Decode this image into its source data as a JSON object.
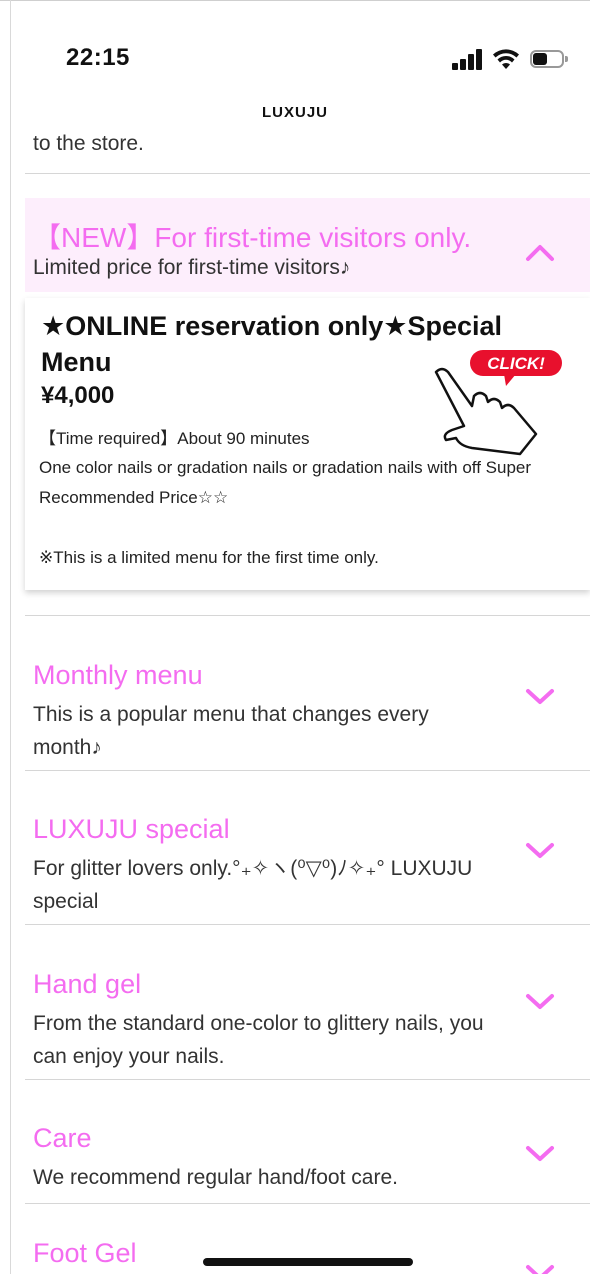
{
  "status_bar": {
    "time": "22:15",
    "battery_level": 0.5
  },
  "app": {
    "title": "LUXUJU"
  },
  "partial_text": "to the store.",
  "new_section": {
    "title": "【NEW】For first-time visitors only.",
    "subtitle": "Limited price for first-time visitors♪",
    "expanded": true,
    "card": {
      "title": "★ONLINE reservation only★Special Menu",
      "price": "¥4,000",
      "time_required": "【Time required】About 90 minutes",
      "description": "One color nails or gradation nails or gradation nails with off Super Recommended Price☆☆",
      "note": "※This is a limited menu for the first time only.",
      "click_badge": "CLICK!"
    }
  },
  "menu_items": [
    {
      "title": "Monthly menu",
      "description": "This is a popular menu that changes every month♪"
    },
    {
      "title": "LUXUJU special",
      "description": "For glitter lovers only.°₊✧ヽ(⁰▽⁰)ﾉ✧₊° LUXUJU special"
    },
    {
      "title": "Hand gel",
      "description": "From the standard one-color to glittery nails, you can enjoy your nails."
    },
    {
      "title": "Care",
      "description": "We recommend regular hand/foot care."
    },
    {
      "title": "Foot Gel",
      "description": ""
    }
  ],
  "colors": {
    "accent": "#f46cf0",
    "section_bg": "#fdeefc",
    "badge_red": "#e8102d"
  },
  "icons": {
    "expand": "chevron-down-icon",
    "collapse": "chevron-up-icon",
    "pointer": "hand-pointer-icon"
  }
}
